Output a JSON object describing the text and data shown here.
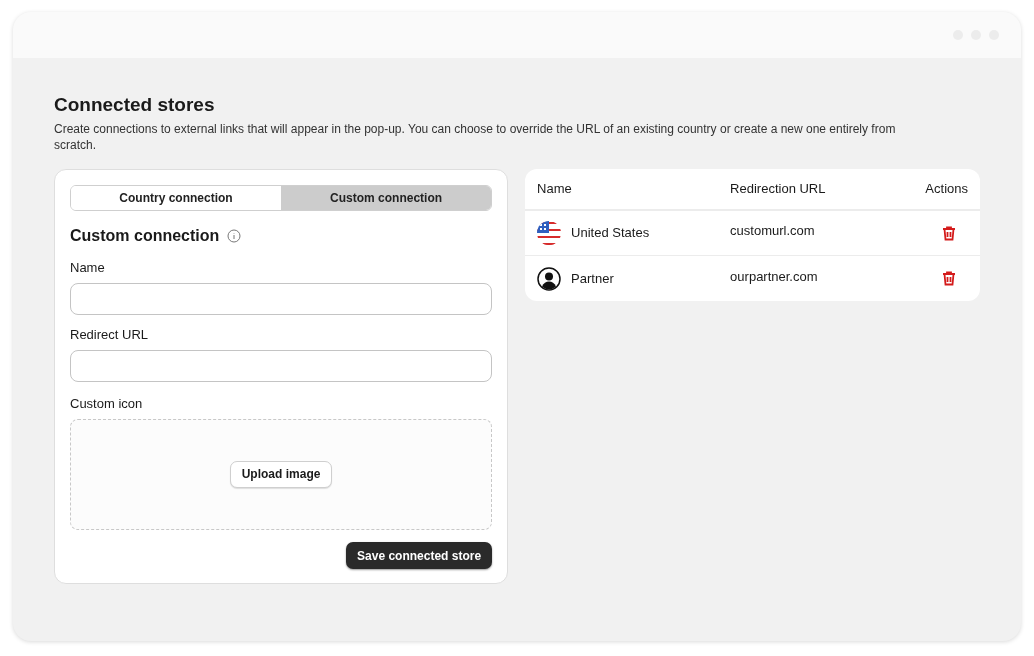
{
  "page": {
    "title": "Connected stores",
    "description": "Create connections to external links that will appear in the pop-up. You can choose to override the URL of an existing country or create a new one entirely from scratch."
  },
  "tabs": [
    {
      "label": "Country connection",
      "selected": false
    },
    {
      "label": "Custom connection",
      "selected": true
    }
  ],
  "form": {
    "title": "Custom connection",
    "fields": [
      {
        "label": "Name"
      },
      {
        "label": "Redirect URL"
      }
    ],
    "upload": {
      "label": "Custom icon",
      "button": "Upload image"
    },
    "submit": "Save connected store"
  },
  "table": {
    "columns": [
      "Name",
      "Redirection URL",
      "Actions"
    ],
    "rows": [
      {
        "kind": "country",
        "name": "United States",
        "url": "customurl.com"
      },
      {
        "kind": "custom",
        "name": "Partner",
        "url": "ourpartner.com"
      }
    ]
  }
}
